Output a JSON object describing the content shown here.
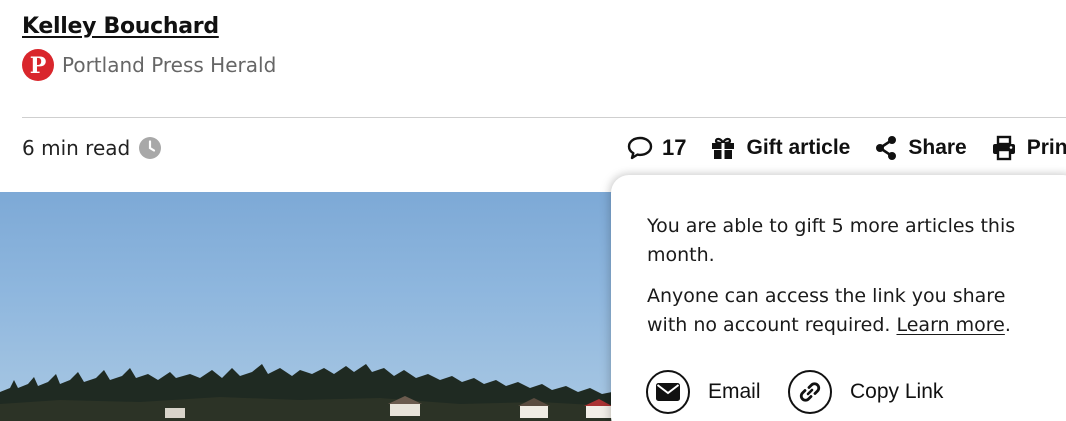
{
  "byline": {
    "author": "Kelley Bouchard",
    "source_name": "Portland Press Herald",
    "source_logo_letter": "P",
    "source_color": "#d9262c"
  },
  "meta": {
    "read_time": "6 min read"
  },
  "actions": {
    "comments_count": "17",
    "gift_label": "Gift article",
    "share_label": "Share",
    "print_label": "Print"
  },
  "gift_popover": {
    "line1": "You are able to gift 5 more articles this month.",
    "line2": "Anyone can access the link you share with no account required.",
    "learn_more": "Learn more",
    "line2_end": ".",
    "email_label": "Email",
    "copy_link_label": "Copy Link"
  },
  "icons": {
    "comments": "speech-bubble-icon",
    "gift": "gift-icon",
    "share": "share-icon",
    "print": "printer-icon",
    "clock": "clock-icon",
    "email": "envelope-icon",
    "copy_link": "link-icon"
  }
}
